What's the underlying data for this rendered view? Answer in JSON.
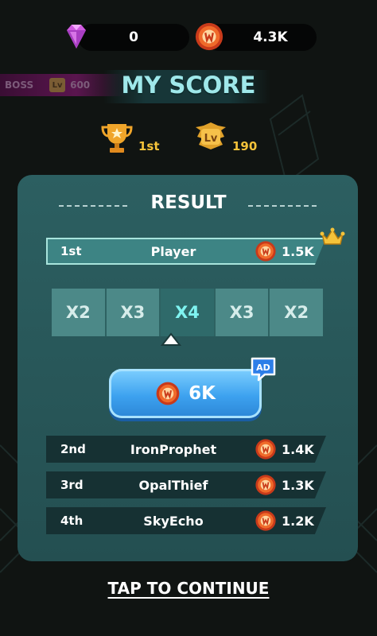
{
  "currency": {
    "gems": "0",
    "coins": "4.3K"
  },
  "boss_tag": {
    "label": "BOSS",
    "level_badge": "Lv",
    "level_value": "600"
  },
  "title": "MY SCORE",
  "stats": {
    "rank": "1st",
    "level_badge": "Lv",
    "level": "190"
  },
  "result": {
    "title": "RESULT",
    "player_row": {
      "rank": "1st",
      "name": "Player",
      "coins": "1.5K"
    },
    "multipliers": [
      "X2",
      "X3",
      "X4",
      "X3",
      "X2"
    ],
    "active_multiplier_index": 2,
    "reward_button": {
      "amount": "6K",
      "badge": "AD"
    },
    "others": [
      {
        "rank": "2nd",
        "name": "IronProphet",
        "coins": "1.4K"
      },
      {
        "rank": "3rd",
        "name": "OpalThief",
        "coins": "1.3K"
      },
      {
        "rank": "4th",
        "name": "SkyEcho",
        "coins": "1.2K"
      }
    ]
  },
  "continue_label": "TAP TO CONTINUE",
  "colors": {
    "accent_title": "#9fe8ea",
    "gold": "#f5c33a",
    "button_blue": "#3da2ef",
    "card": "#2c5f61"
  }
}
